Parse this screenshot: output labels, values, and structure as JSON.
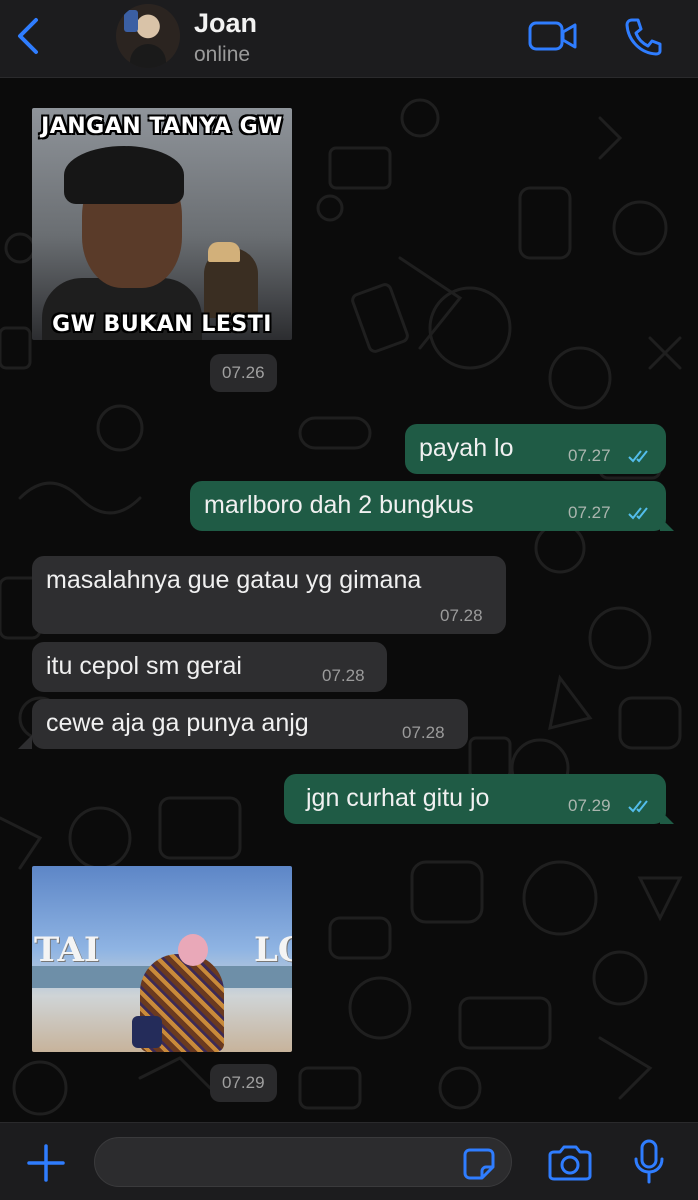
{
  "header": {
    "contact_name": "Joan",
    "status": "online"
  },
  "messages": [
    {
      "type": "image",
      "direction": "in",
      "caption_top": "JANGAN TANYA GW",
      "caption_bottom": "GW BUKAN LESTI",
      "time": "07.26"
    },
    {
      "type": "text",
      "direction": "out",
      "text": "payah lo",
      "time": "07.27",
      "read": true
    },
    {
      "type": "text",
      "direction": "out",
      "text": "marlboro dah 2 bungkus",
      "time": "07.27",
      "read": true
    },
    {
      "type": "text",
      "direction": "in",
      "text": "masalahnya gue gatau yg gimana",
      "time": "07.28"
    },
    {
      "type": "text",
      "direction": "in",
      "text": "itu cepol sm gerai",
      "time": "07.28"
    },
    {
      "type": "text",
      "direction": "in",
      "text": "cewe aja ga punya anjg",
      "time": "07.28"
    },
    {
      "type": "text",
      "direction": "out",
      "text": "jgn curhat gitu jo",
      "time": "07.29",
      "read": true
    },
    {
      "type": "image",
      "direction": "in",
      "sign_left": "TAI",
      "sign_right": "LO",
      "time": "07.29"
    }
  ],
  "composer": {
    "placeholder": ""
  },
  "colors": {
    "accent": "#2f7dff",
    "outgoing_bubble": "#1f5b45",
    "incoming_bubble": "#2e2e30",
    "read_tick": "#53bdeb",
    "background": "#0b0b0b"
  },
  "icons": {
    "back": "chevron-left-icon",
    "video": "video-camera-icon",
    "call": "phone-icon",
    "attach": "plus-icon",
    "sticker": "sticker-icon",
    "camera": "camera-icon",
    "mic": "microphone-icon",
    "read": "double-check-icon"
  }
}
